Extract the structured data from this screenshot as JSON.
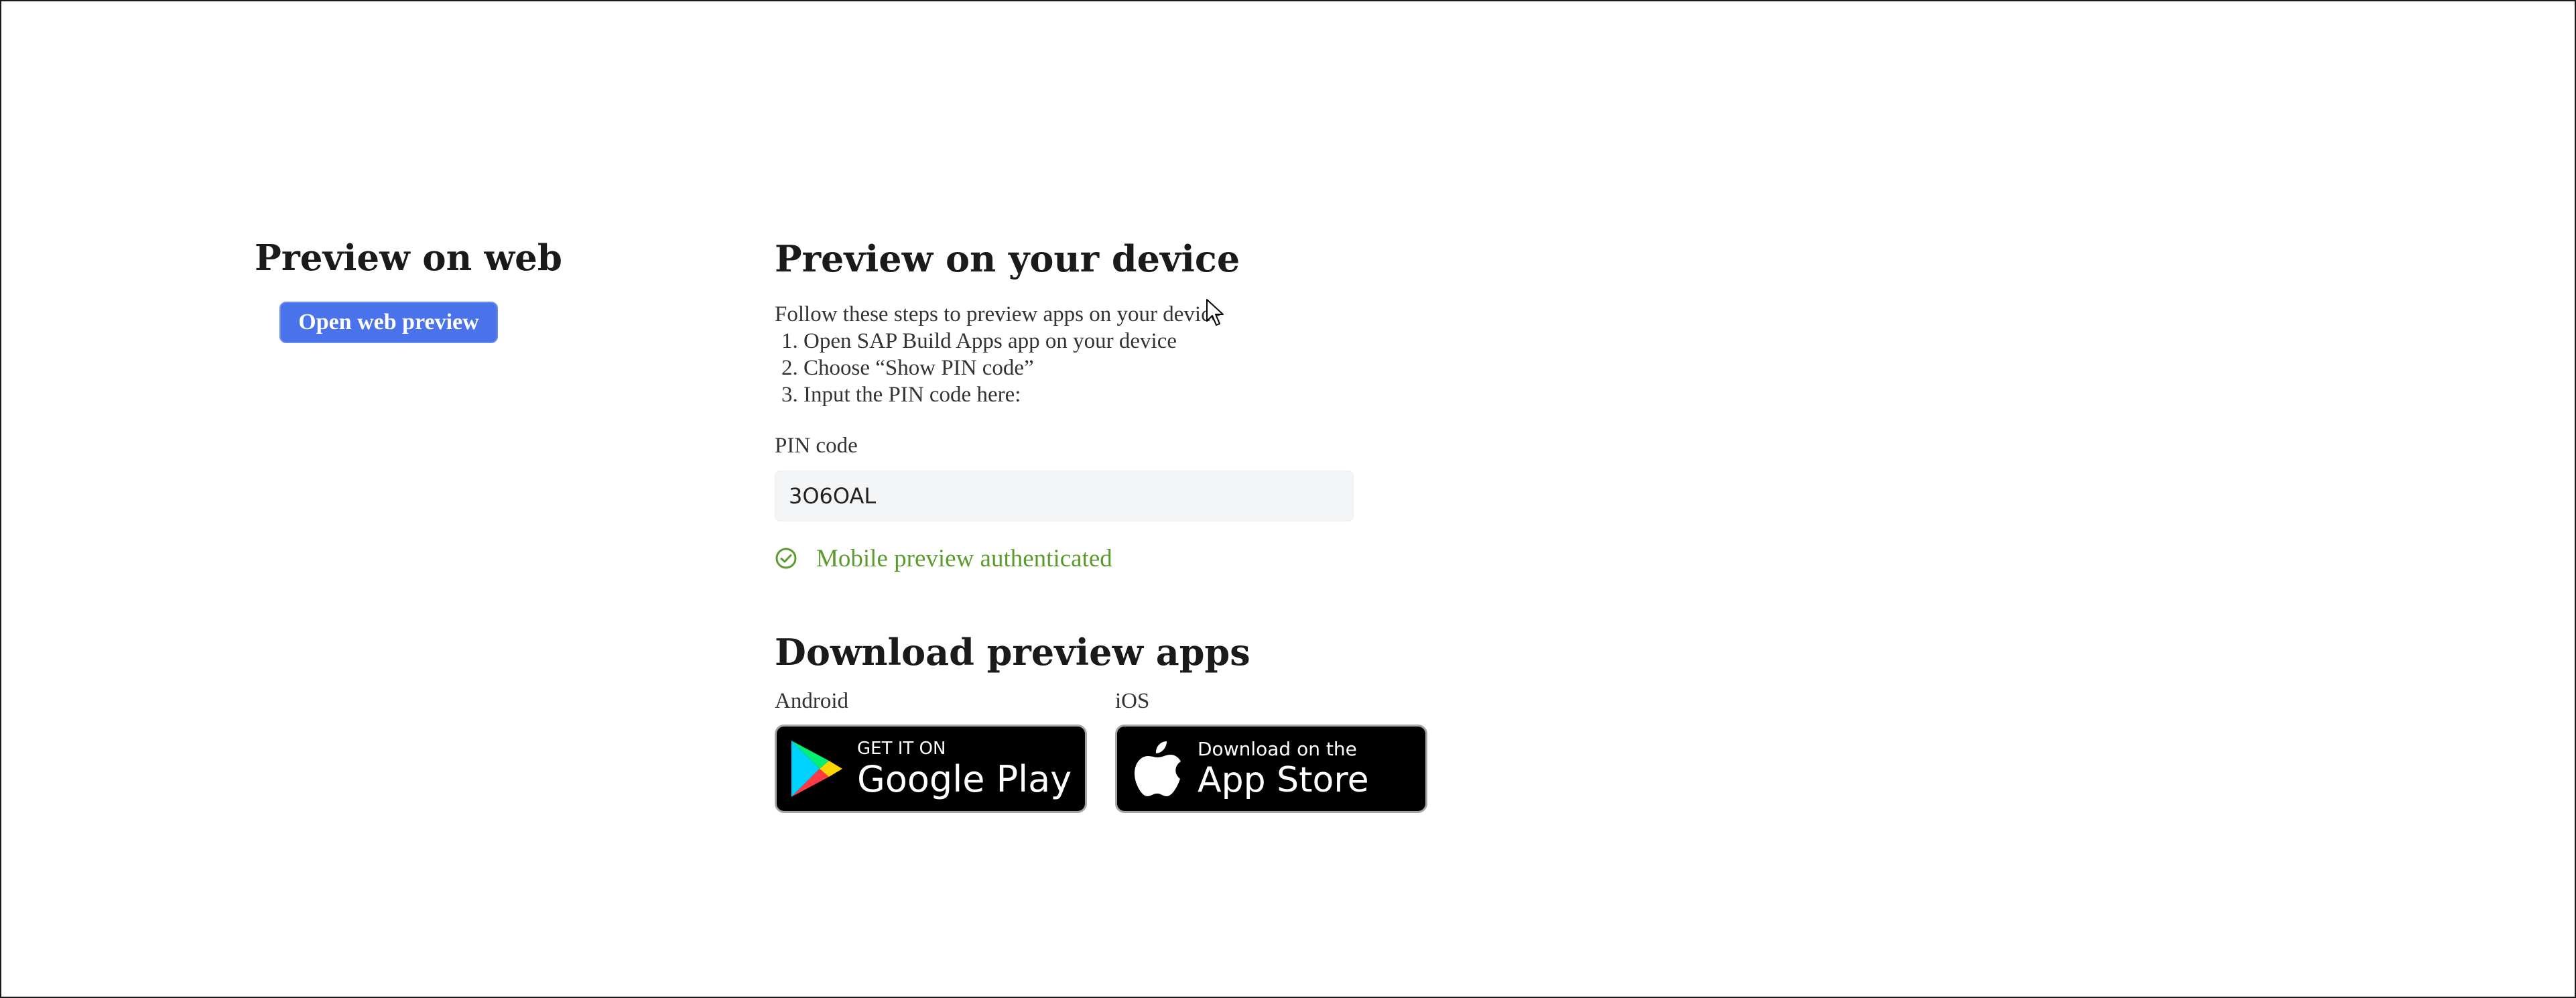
{
  "web": {
    "title": "Preview on web",
    "open_button_label": "Open web preview"
  },
  "device": {
    "title": "Preview on your device",
    "intro": "Follow these steps to preview apps on your device",
    "steps": [
      "Open SAP Build Apps app on your device",
      "Choose “Show PIN code”",
      "Input the PIN code here:"
    ],
    "pin_label": "PIN code",
    "pin_value": "3O6OAL",
    "auth_status": "Mobile preview authenticated",
    "auth_icon": "check-circle-icon"
  },
  "download": {
    "title": "Download preview apps",
    "android": {
      "label": "Android",
      "badge_small": "GET IT ON",
      "badge_big": "Google Play",
      "icon": "google-play-icon"
    },
    "ios": {
      "label": "iOS",
      "badge_small": "Download on the",
      "badge_big": "App Store",
      "icon": "apple-icon"
    }
  },
  "colors": {
    "button": "#4a72ea",
    "success": "#5b9b2e",
    "input_bg": "#f4f5f6"
  }
}
